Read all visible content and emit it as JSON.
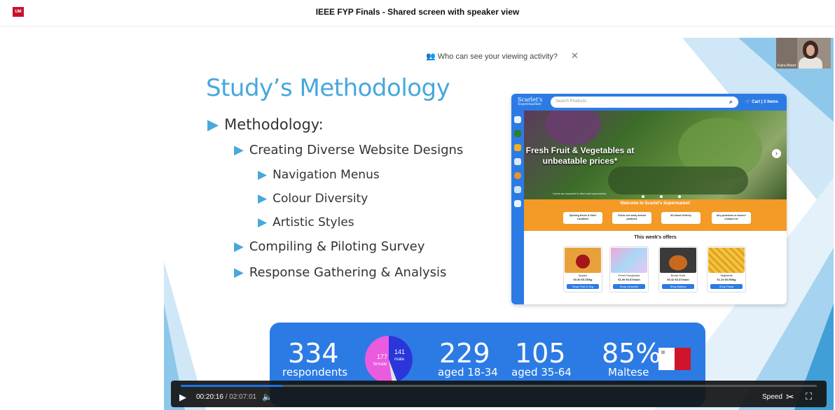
{
  "app": {
    "title": "IEEE FYP Finals - Shared screen with speaker view",
    "logo_text": "UM"
  },
  "privacy": {
    "text": "Who can see your viewing activity?",
    "close": "✕"
  },
  "slide": {
    "title": "Study’s Methodology",
    "bullets": {
      "l1": "Methodology:",
      "creating": "Creating Diverse Website Designs",
      "nav": "Navigation Menus",
      "colour": "Colour Diversity",
      "artistic": "Artistic Styles",
      "compiling": "Compiling & Piloting Survey",
      "response": "Response Gathering & Analysis"
    },
    "stats": {
      "respondents_n": "334",
      "respondents_l": "respondents",
      "female_n": "177",
      "female_l": "female",
      "male_n": "141",
      "male_l": "male",
      "aged1_n": "229",
      "aged1_l": "aged 18-34",
      "aged2_n": "105",
      "aged2_l": "aged 35-64",
      "maltese_n": "85%",
      "maltese_l": "Maltese"
    }
  },
  "webcam": {
    "name": "Kaira Attard"
  },
  "shop": {
    "logo": "Scarlet's",
    "logo_sub": "Supermarket",
    "search_placeholder": "Search Products",
    "cart": "Cart | 2 Items",
    "hero": "Fresh Fruit & Vegetables at unbeatable prices*",
    "hero_note": "* prices are compared to other local supermarkets",
    "welcome": "Welcome to Scarlet's Supermarket!",
    "info": [
      "Opening Hours & Store Locations",
      "Check out newly arrived products",
      "All About Delivery",
      "Any questions or issues? Contact Us!"
    ],
    "offers_title": "This week's offers",
    "offers": [
      {
        "name": "Apples",
        "price": "€0.30 €0.25/kg",
        "btn": "Shop Fruit & Veg"
      },
      {
        "name": "Fresh Doughnuts",
        "price": "€1.00 €0.67/each",
        "btn": "Shop Desserts"
      },
      {
        "name": "Bread Rolls",
        "price": "€0.42 €0.37/each",
        "btn": "Shop Bakery"
      },
      {
        "name": "Tagliatelle",
        "price": "€1.10 €0.95/kg",
        "btn": "Shop Pasta"
      }
    ]
  },
  "player": {
    "current": "00:20:16",
    "separator": " / ",
    "total": "02:07:01",
    "speed": "Speed",
    "progress": 0.16
  },
  "colors": {
    "accent": "#2c7be5",
    "slide_blue": "#47a8dc",
    "orange": "#f39a27"
  }
}
